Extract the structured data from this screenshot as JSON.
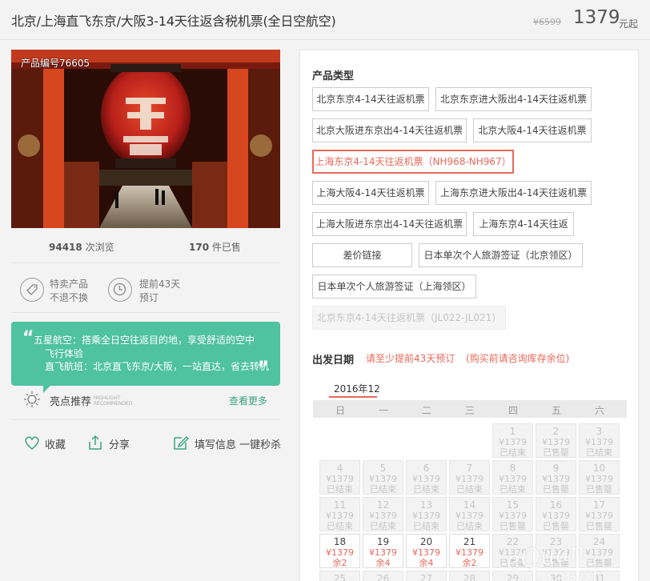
{
  "header": {
    "title": "北京/上海直飞东京/大阪3-14天往返含税机票(全日空航空)",
    "old_price": "¥6599",
    "price": "1379",
    "unit": "元起"
  },
  "photo": {
    "code": "产品编号76605"
  },
  "stats": {
    "views_num": "94418",
    "views_label": " 次浏览",
    "sold_num": "170",
    "sold_label": " 件已售"
  },
  "features": [
    {
      "line1": "特卖产品",
      "line2": "不退不换",
      "icon": "tag-icon"
    },
    {
      "line1": "提前43天",
      "line2": "预订",
      "icon": "clock-icon"
    }
  ],
  "promo": {
    "line1": "五星航空：搭乘全日空往返目的地，享受舒适的空中",
    "line2": "飞行体验",
    "line3": "直飞航班：北京直飞东京/大阪，一站直达，省去转机"
  },
  "highlight": {
    "label": "亮点推荐",
    "en1": "HIGHLIGHT",
    "en2": "RECOMMENDED",
    "more": "查看更多"
  },
  "actions": {
    "fav": "收藏",
    "share": "分享",
    "fill": "填写信息 一键秒杀"
  },
  "product_type": {
    "title": "产品类型",
    "options": [
      "北京东京4-14天往返机票",
      "北京东京进大阪出4-14天往返机票",
      "北京大阪进东京出4-14天往返机票",
      "北京大阪4-14天往返机票",
      "上海东京4-14天往返机票（NH968-NH967）",
      "上海大阪4-14天往返机票",
      "上海东京进大阪出4-14天往返机票",
      "上海大阪进东京出4-14天往返机票",
      "上海东京4-14天往返",
      "差价链接",
      "日本单次个人旅游签证（北京领区）",
      "日本单次个人旅游签证（上海领区）",
      "北京东京4-14天往返机票（JL022-JL021）"
    ],
    "selected": "上海东京4-14天往返机票（NH968-NH967）",
    "disabled": "北京东京4-14天往返机票（JL022-JL021）"
  },
  "departure": {
    "title": "出发日期",
    "notice1": "请至少提前43天预订",
    "notice2": "(购买前请咨询库存余位)",
    "month": "2016年12",
    "weekdays": [
      "日",
      "一",
      "二",
      "三",
      "四",
      "五",
      "六"
    ],
    "days": [
      {
        "day": "1",
        "price": "¥1379",
        "status": "已结束"
      },
      {
        "day": "2",
        "price": "¥1379",
        "status": "已售罄"
      },
      {
        "day": "3",
        "price": "¥1379",
        "status": "已结束"
      },
      {
        "day": "4",
        "price": "¥1379",
        "status": "已结束"
      },
      {
        "day": "5",
        "price": "¥1379",
        "status": "已结束"
      },
      {
        "day": "6",
        "price": "¥1379",
        "status": "已结束"
      },
      {
        "day": "7",
        "price": "¥1379",
        "status": "已结束"
      },
      {
        "day": "8",
        "price": "¥1379",
        "status": "已结束"
      },
      {
        "day": "9",
        "price": "¥1379",
        "status": "已售罄"
      },
      {
        "day": "10",
        "price": "¥1379",
        "status": "已售罄"
      },
      {
        "day": "11",
        "price": "¥1379",
        "status": "已结束"
      },
      {
        "day": "12",
        "price": "¥1379",
        "status": "已结束"
      },
      {
        "day": "13",
        "price": "¥1379",
        "status": "已结束"
      },
      {
        "day": "14",
        "price": "¥1379",
        "status": "已结束"
      },
      {
        "day": "15",
        "price": "¥1379",
        "status": "已售罄"
      },
      {
        "day": "16",
        "price": "¥1379",
        "status": "已售罄"
      },
      {
        "day": "17",
        "price": "¥1379",
        "status": "已售罄"
      },
      {
        "day": "18",
        "price": "¥1379",
        "status": "余2"
      },
      {
        "day": "19",
        "price": "¥1379",
        "status": "余4"
      },
      {
        "day": "20",
        "price": "¥1379",
        "status": "余4"
      },
      {
        "day": "21",
        "price": "¥1379",
        "status": "余2"
      },
      {
        "day": "22",
        "price": "¥1379",
        "status": "已售罄"
      },
      {
        "day": "23",
        "price": "¥1379",
        "status": "已售罄"
      },
      {
        "day": "24",
        "price": "¥1379",
        "status": "已售罄"
      },
      {
        "day": "25",
        "price": "",
        "status": ""
      },
      {
        "day": "26",
        "price": "",
        "status": ""
      },
      {
        "day": "27",
        "price": "",
        "status": ""
      },
      {
        "day": "28",
        "price": "",
        "status": ""
      },
      {
        "day": "29",
        "price": "",
        "status": ""
      },
      {
        "day": "30",
        "price": "",
        "status": ""
      },
      {
        "day": "31",
        "price": "",
        "status": ""
      }
    ]
  },
  "watermark": "eQuan Xingset"
}
